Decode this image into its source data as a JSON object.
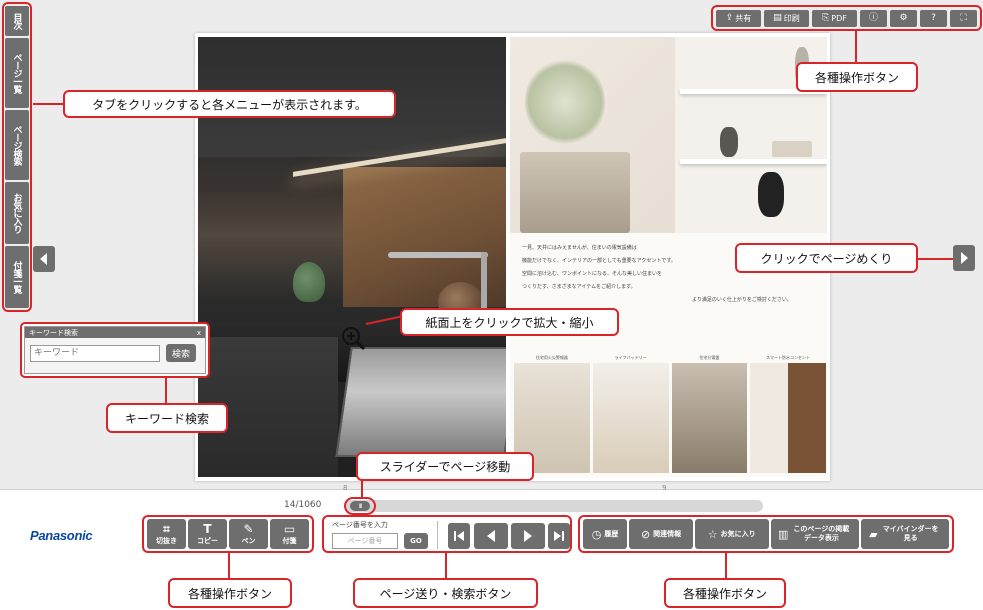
{
  "left_tabs": [
    "目次",
    "ページ一覧",
    "ページ検索",
    "お気に入り",
    "付箋一覧"
  ],
  "top_toolbar": [
    {
      "icon": "share-icon",
      "glyph": "⇪",
      "label": "共有"
    },
    {
      "icon": "print-icon",
      "glyph": "▤",
      "label": "印刷"
    },
    {
      "icon": "pdf-icon",
      "glyph": "⎘",
      "label": "PDF"
    },
    {
      "icon": "info-icon",
      "glyph": "ⓘ",
      "label": ""
    },
    {
      "icon": "gear-icon",
      "glyph": "⚙",
      "label": ""
    },
    {
      "icon": "help-icon",
      "glyph": "?",
      "label": ""
    },
    {
      "icon": "fullscreen-icon",
      "glyph": "⛶",
      "label": ""
    }
  ],
  "book": {
    "right_text": [
      "一見、天井にはみえませんが、住まいの電気設備は",
      "機能だけでなく、インテリアの一部としても重要なアクセントです。",
      "空間に溶け込む、ワンポイントになる、そんな美しい住まいを",
      "つくりだす、さまざまなアイテムをご紹介します。",
      "より満足のいく仕上がりをご検討ください。"
    ],
    "thumb_captions": [
      "住宅用火災警報器",
      "ライフバッテリー",
      "住宅分電盤",
      "スマート防水コンセント"
    ]
  },
  "keyword_search": {
    "title": "キーワード検索",
    "close": "x",
    "placeholder": "キーワード",
    "button": "検索"
  },
  "callouts": {
    "tabs": "タブをクリックすると各メニューが表示されます。",
    "top_buttons": "各種操作ボタン",
    "page_turn": "クリックでページめくり",
    "zoom": "紙面上をクリックで拡大・縮小",
    "keyword": "キーワード検索",
    "slider": "スライダーでページ移動",
    "bottom_left": "各種操作ボタン",
    "page_nav": "ページ送り・検索ボタン",
    "bottom_right": "各種操作ボタン"
  },
  "slider": {
    "page_count": "14/1060",
    "knob": "III",
    "tick1": "8",
    "tick2": "9"
  },
  "logo": "Panasonic",
  "tools": [
    {
      "icon": "crop-icon",
      "glyph": "⌗",
      "label": "切抜き"
    },
    {
      "icon": "text-icon",
      "glyph": "T",
      "label": "コピー"
    },
    {
      "icon": "pen-icon",
      "glyph": "✎",
      "label": "ペン"
    },
    {
      "icon": "sticky-note-icon",
      "glyph": "▭",
      "label": "付箋"
    }
  ],
  "page_search": {
    "label": "ページ番号を入力",
    "placeholder": "ページ番号",
    "go": "GO"
  },
  "right_tools": [
    {
      "icon": "history-icon",
      "glyph": "◷",
      "label": "履歴"
    },
    {
      "icon": "related-info-icon",
      "glyph": "⊘",
      "label": "関連情報"
    },
    {
      "icon": "star-icon",
      "glyph": "☆",
      "label": "お気に入り"
    },
    {
      "icon": "book-data-icon",
      "glyph": "▥",
      "label": "このページの掲載データ表示"
    },
    {
      "icon": "folder-icon",
      "glyph": "▰",
      "label": "マイバインダーを見る"
    }
  ],
  "colors": {
    "accent_red": "#d9242a",
    "button_gray": "#6e6e6e",
    "brand_blue": "#0a47a6"
  }
}
